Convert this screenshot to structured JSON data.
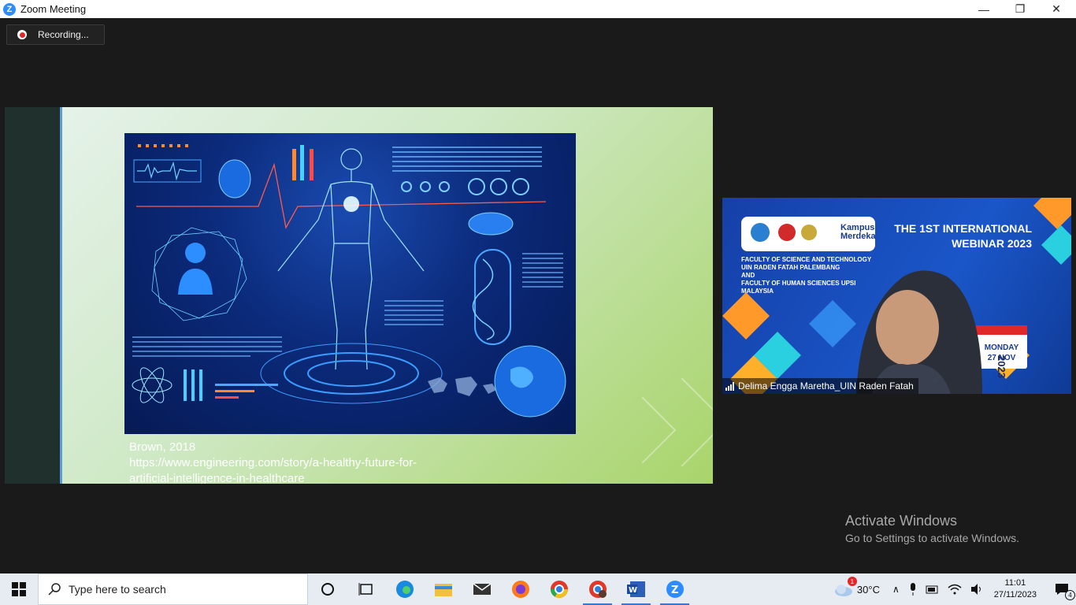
{
  "window": {
    "title": "Zoom Meeting",
    "minimize_glyph": "—",
    "restore_glyph": "❐",
    "close_glyph": "✕"
  },
  "recording": {
    "label": "Recording..."
  },
  "slide": {
    "citation": "Brown, 2018",
    "url_line1": "https://www.engineering.com/story/a-healthy-future-for-",
    "url_line2": "artificial-intelligence-in-healthcare"
  },
  "participant": {
    "name": "Delima Engga Maretha_UIN Raden Fatah",
    "banner_title_line1": "THE 1ST INTERNATIONAL",
    "banner_title_line2": "WEBINAR 2023",
    "faculty_lines": [
      "FACULTY OF SCIENCE AND TECHNOLOGY",
      "UIN RADEN FATAH PALEMBANG",
      "AND",
      "FACULTY OF HUMAN SCIENCES UPSI",
      "MALAYSIA"
    ],
    "logo_text": "Kampus Merdeka",
    "date_day": "MONDAY",
    "date_date": "27 NOV",
    "date_year": "2023"
  },
  "watermark": {
    "line1": "Activate Windows",
    "line2": "Go to Settings to activate Windows."
  },
  "taskbar": {
    "search_placeholder": "Type here to search",
    "weather_temp": "30°C",
    "weather_badge": "1",
    "time": "11:01",
    "date": "27/11/2023",
    "notification_count": "4"
  },
  "colors": {
    "zoom_blue": "#2d8cff",
    "record_red": "#e02828",
    "slide_bg_light": "#e8f3ee",
    "slide_bg_green": "#a9d46a",
    "tile_blue": "#1a56c8"
  }
}
